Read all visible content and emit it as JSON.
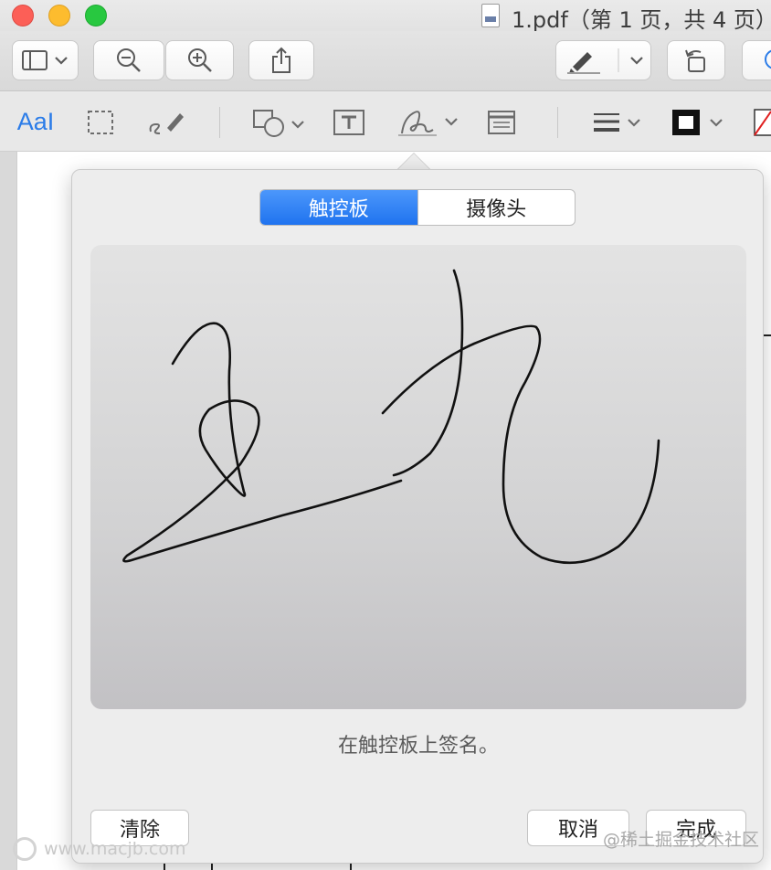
{
  "window": {
    "title": "1.pdf（第 1 页，共 4 页）"
  },
  "toolbar": {
    "sidebar_icon": "sidebar-icon",
    "zoom_out_icon": "zoom-out-icon",
    "zoom_in_icon": "zoom-in-icon",
    "share_icon": "share-icon",
    "highlight_icon": "highlighter-icon",
    "rotate_icon": "rotate-icon"
  },
  "markup": {
    "text_style_label": "AaI"
  },
  "signature_panel": {
    "tabs": [
      {
        "label": "触控板",
        "active": true
      },
      {
        "label": "摄像头",
        "active": false
      }
    ],
    "hint": "在触控板上签名。",
    "clear_label": "清除",
    "cancel_label": "取消",
    "done_label": "完成"
  },
  "watermarks": {
    "left": "www.macjb.com",
    "right": "@稀土掘金技术社区"
  },
  "colors": {
    "accent": "#1f73ef",
    "close": "#fc5f57",
    "minimize": "#fdbc2e",
    "zoom": "#28c840"
  }
}
